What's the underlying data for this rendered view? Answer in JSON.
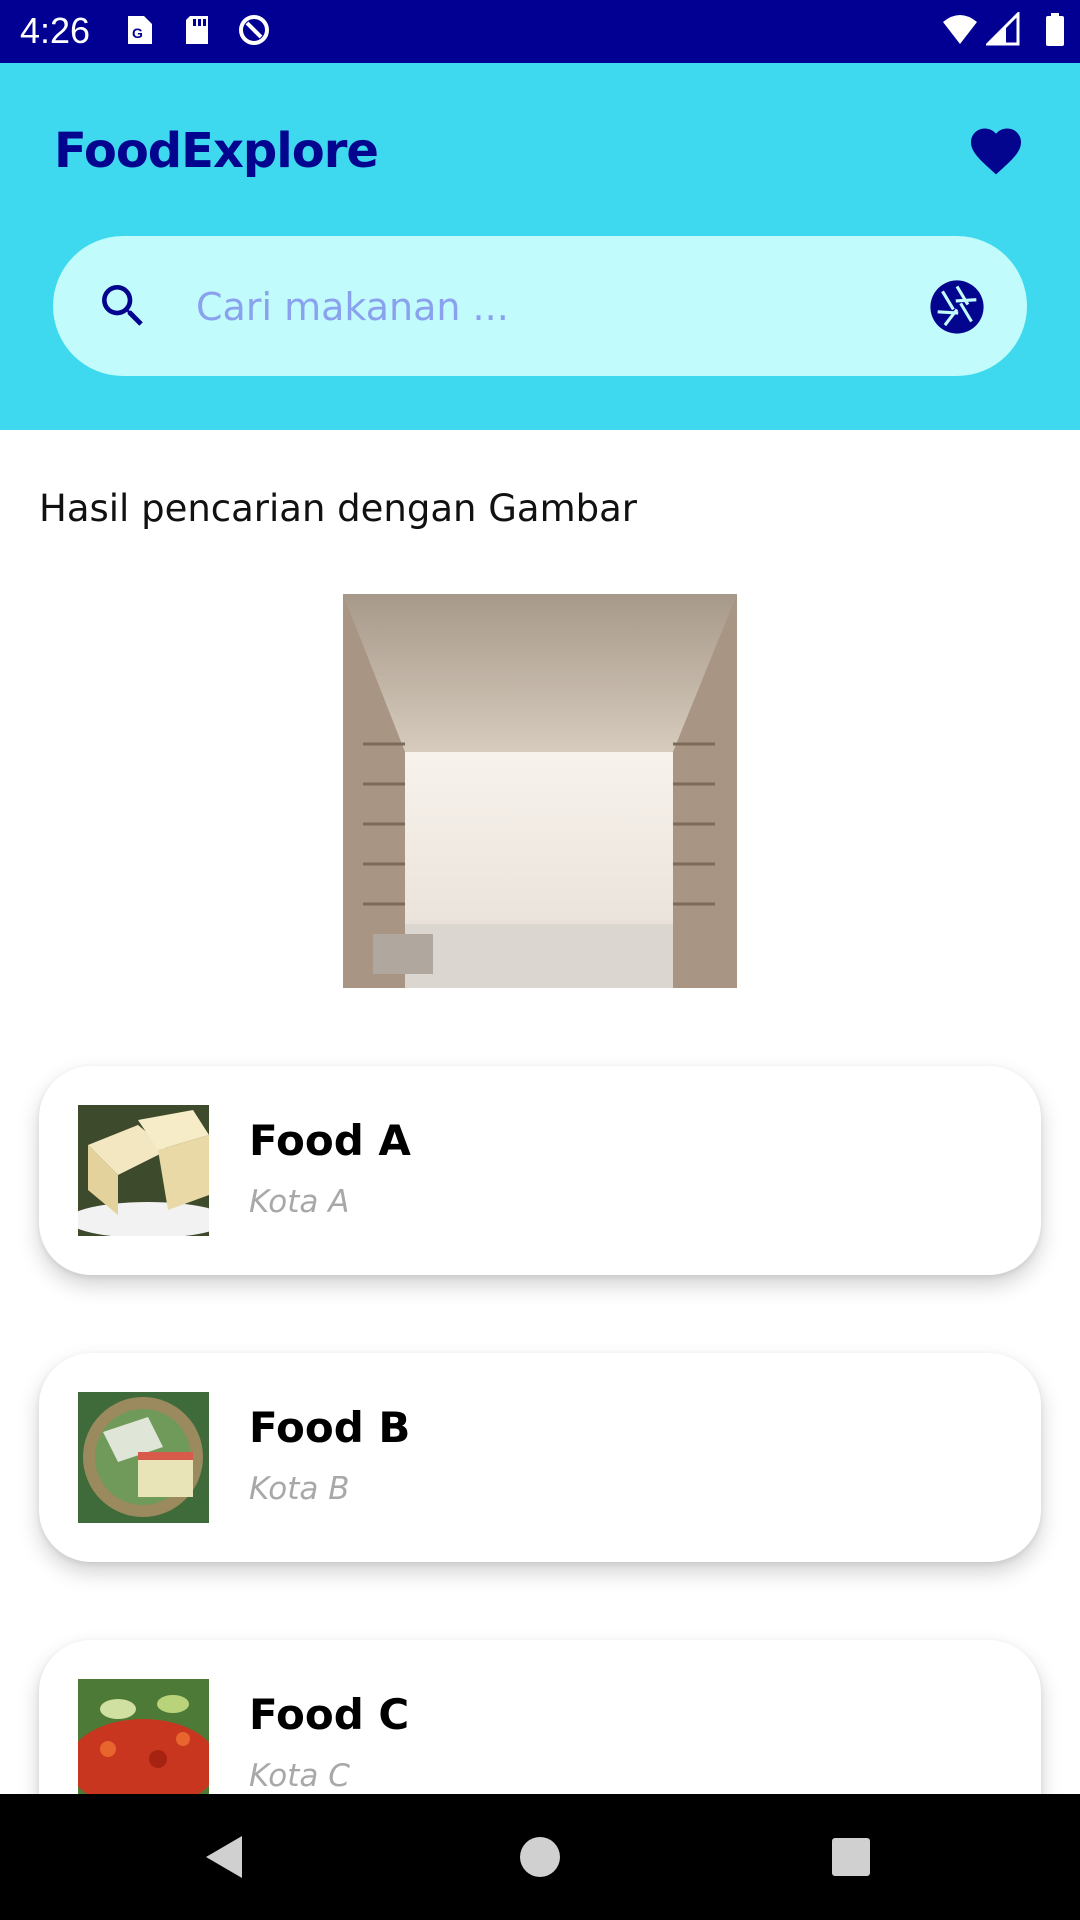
{
  "status_bar": {
    "time": "4:26",
    "left_icons": [
      "maps-notification-icon",
      "sd-card-icon",
      "sync-icon"
    ],
    "right_icons": [
      "wifi-icon",
      "cellular-signal-icon",
      "battery-icon"
    ],
    "bg_color": "#020092"
  },
  "header": {
    "title": "FoodExplore",
    "favorite_icon": "heart-icon",
    "bg_color": "#3ed9ef",
    "accent_color": "#04058e"
  },
  "search": {
    "placeholder": "Cari makanan ...",
    "value": "",
    "search_icon": "search-icon",
    "camera_icon": "camera-shutter-icon",
    "bg_color": "#c2fbfb"
  },
  "results": {
    "section_title": "Hasil pencarian dengan Gambar",
    "items": [
      {
        "name": "Food A",
        "city": "Kota A"
      },
      {
        "name": "Food B",
        "city": "Kota B"
      },
      {
        "name": "Food C",
        "city": "Kota C"
      }
    ]
  },
  "nav_bar": {
    "buttons": [
      "back-icon",
      "home-icon",
      "recents-icon"
    ]
  }
}
